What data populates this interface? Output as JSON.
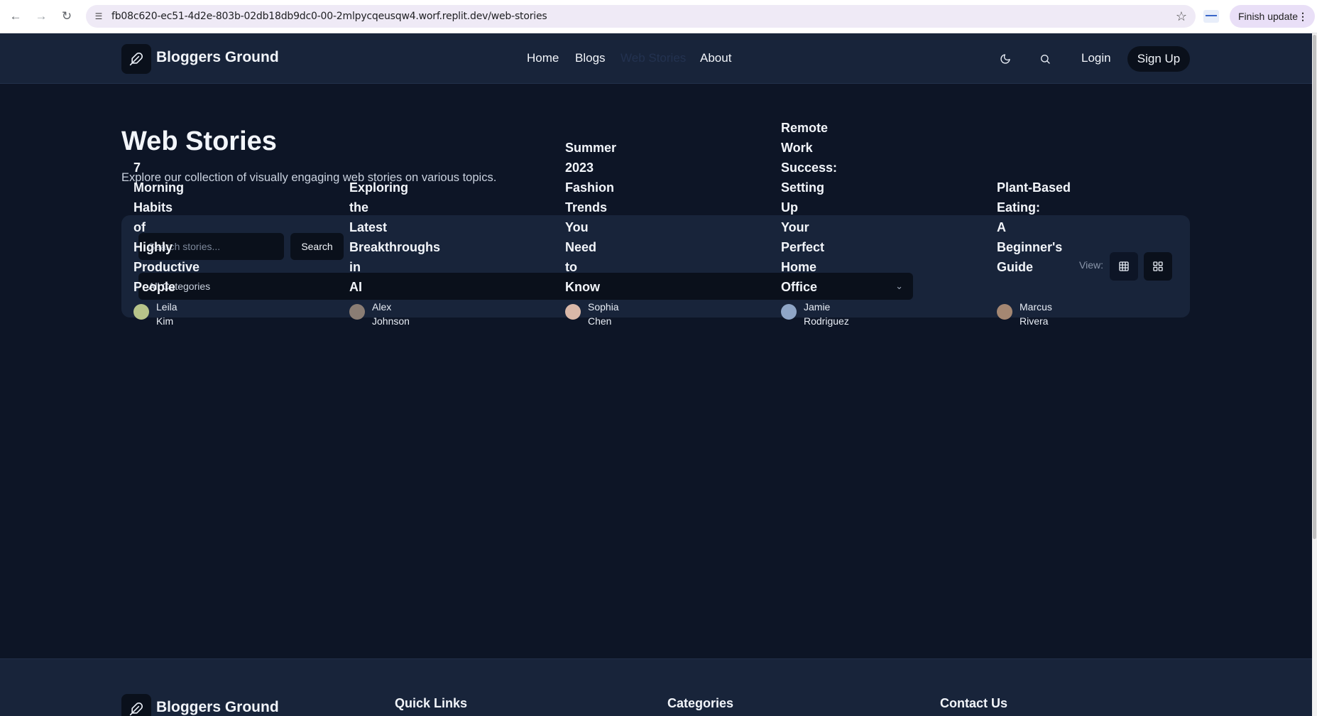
{
  "browser": {
    "url": "fb08c620-ec51-4d2e-803b-02db18db9dc0-00-2mlpycqeusqw4.worf.replit.dev/web-stories",
    "finish_update": "Finish update"
  },
  "header": {
    "brand": "Bloggers Ground",
    "nav": [
      {
        "label": "Home"
      },
      {
        "label": "Blogs"
      },
      {
        "label": "Web Stories",
        "active": true
      },
      {
        "label": "About"
      }
    ],
    "login": "Login",
    "signup": "Sign Up"
  },
  "page": {
    "title": "Web Stories",
    "subtitle": "Explore our collection of visually engaging web stories on various topics."
  },
  "filters": {
    "search_placeholder": "Search stories...",
    "search_button": "Search",
    "category_selected": "All Categories",
    "view_label": "View:"
  },
  "stories": [
    {
      "title": "7 Morning Habits of Highly Productive People",
      "author": "Leila Kim",
      "avatar_color": "#b7c48a"
    },
    {
      "title": "Exploring the Latest Breakthroughs in AI",
      "author": "Alex Johnson",
      "avatar_color": "#8a7d74"
    },
    {
      "title": "Summer 2023 Fashion Trends You Need to Know",
      "author": "Sophia Chen",
      "avatar_color": "#d9b8a8"
    },
    {
      "title": "Remote Work Success: Setting Up Your Perfect Home Office",
      "author": "Jamie Rodriguez",
      "avatar_color": "#8fa6c7"
    },
    {
      "title": "Plant-Based Eating: A Beginner's Guide",
      "author": "Marcus Rivera",
      "avatar_color": "#a48772"
    }
  ],
  "footer": {
    "brand": "Bloggers Ground",
    "quick_links": "Quick Links",
    "categories": "Categories",
    "contact": "Contact Us"
  },
  "colors": {
    "page_bg": "#0d1526",
    "header_bg": "#18243a",
    "control_bg": "#0a101b",
    "text": "#f2f5fa"
  }
}
